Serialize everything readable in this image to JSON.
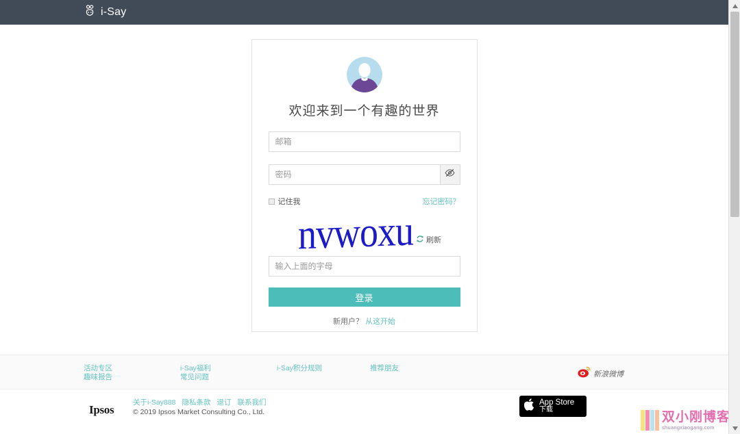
{
  "header": {
    "brand_name": "i-Say",
    "logo_icon": "isay-logo-icon",
    "bg_color": "#414b58"
  },
  "login_card": {
    "avatar_icon": "user-avatar-icon",
    "title": "欢迎来到一个有趣的世界",
    "email": {
      "placeholder": "邮箱",
      "value": ""
    },
    "password": {
      "placeholder": "密码",
      "value": "",
      "toggle_icon": "eye-slash-icon"
    },
    "remember_me": {
      "label": "记住我",
      "checked": false
    },
    "forgot_password": "忘记密码？",
    "captcha": {
      "text": "nvwoxu",
      "refresh_label": "刷新",
      "refresh_icon": "refresh-icon",
      "color": "#1b1bc9"
    },
    "captcha_input": {
      "placeholder": "输入上面的字母",
      "value": ""
    },
    "login_button": {
      "label": "登录",
      "color": "#4dbdb9"
    },
    "signup": {
      "prompt": "新用户？",
      "link": "从这开始"
    }
  },
  "footer_links": {
    "columns": [
      {
        "items": [
          "活动专区",
          "趣味报告"
        ]
      },
      {
        "items": [
          "i-Say福利",
          "常见问题"
        ]
      },
      {
        "items": [
          "i-Say积分规则"
        ]
      },
      {
        "items": [
          "推荐朋友"
        ]
      }
    ],
    "weibo": {
      "label": "新浪微博",
      "icon": "weibo-icon"
    },
    "accent_color": "#63c3c0"
  },
  "footer_bottom": {
    "brand": "Ipsos",
    "legal_links": [
      "关于i-Say888",
      "隐私条款",
      "退订",
      "联系我们"
    ],
    "copyright": "© 2019 Ipsos Market Consulting Co., Ltd.",
    "app_store": {
      "icon": "apple-icon",
      "line1": "App Store",
      "line2": "下载"
    }
  },
  "watermark": {
    "title": "双小刚博客",
    "url": "shuangxiaogang.com"
  },
  "scrollbar": {
    "up_icon": "scroll-up-arrow-icon",
    "down_icon": "scroll-down-arrow-icon"
  }
}
